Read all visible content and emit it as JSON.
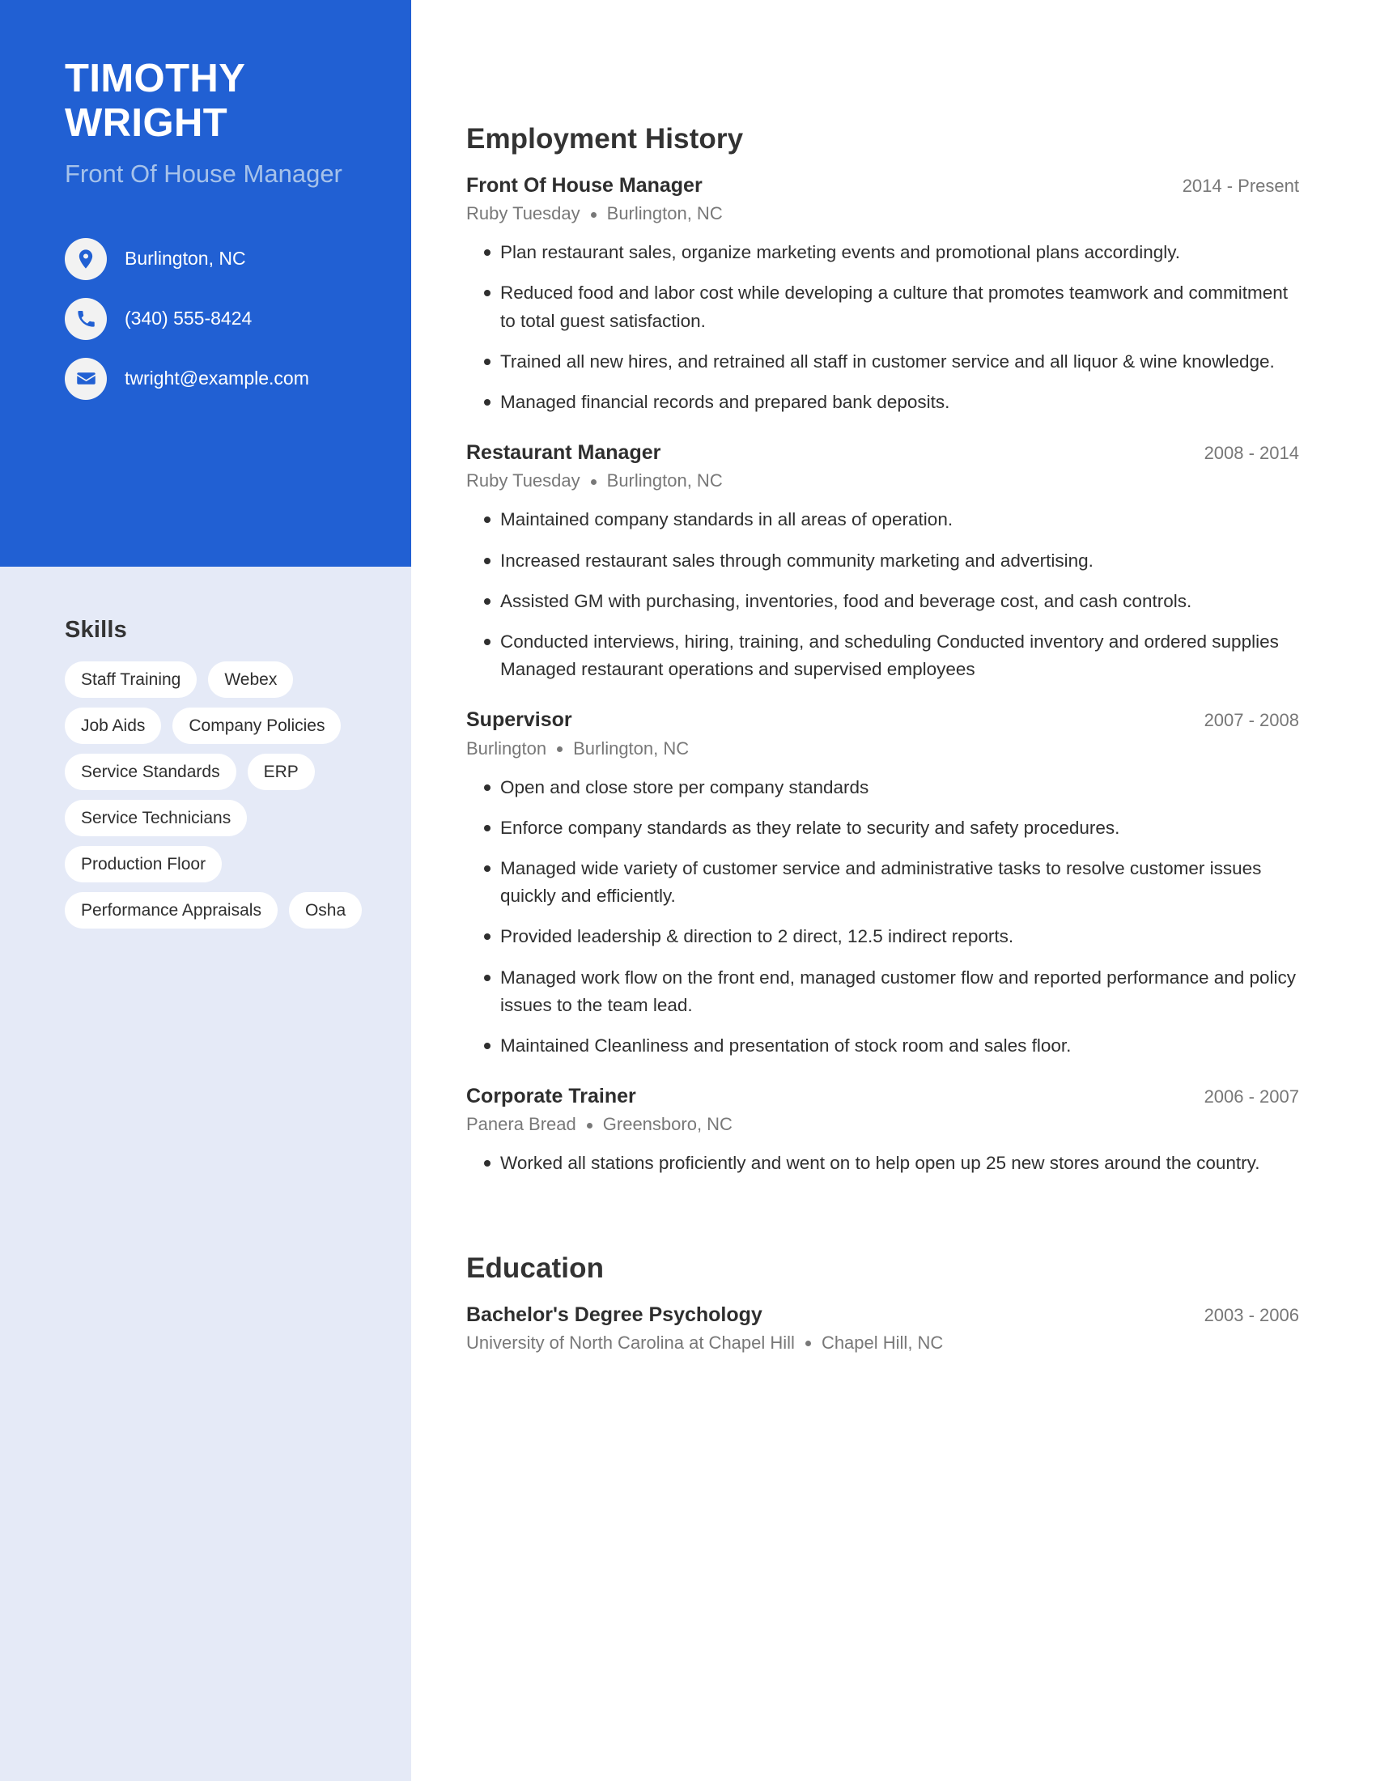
{
  "theme": {
    "accent_blue": "#2160d3",
    "sidebar_bg": "#e5eaf7",
    "subtitle_blue": "#a6c2ea",
    "body_text": "#2f2f2f",
    "muted_text": "#787878"
  },
  "sidebar": {
    "name": "TIMOTHY WRIGHT",
    "headline": "Front Of House Manager",
    "contact": [
      {
        "icon": "location-pin-icon",
        "label": "Burlington, NC"
      },
      {
        "icon": "phone-icon",
        "label": "(340) 555-8424"
      },
      {
        "icon": "envelope-icon",
        "label": "twright@example.com"
      }
    ],
    "skills_heading": "Skills",
    "skills": [
      "Staff Training",
      "Webex",
      "Job Aids",
      "Company Policies",
      "Service Standards",
      "ERP",
      "Service Technicians",
      "Production Floor",
      "Performance Appraisals",
      "Osha"
    ]
  },
  "main": {
    "employment": {
      "heading": "Employment History",
      "entries": [
        {
          "title": "Front Of House Manager",
          "dates": "2014 - Present",
          "company": "Ruby Tuesday",
          "location": "Burlington, NC",
          "bullets": [
            "Plan restaurant sales, organize marketing events and promotional plans accordingly.",
            "Reduced food and labor cost while developing a culture that promotes teamwork and commitment to total guest satisfaction.",
            "Trained all new hires, and retrained all staff in customer service and all liquor & wine knowledge.",
            "Managed financial records and prepared bank deposits."
          ]
        },
        {
          "title": "Restaurant Manager",
          "dates": "2008 - 2014",
          "company": "Ruby Tuesday",
          "location": "Burlington, NC",
          "bullets": [
            "Maintained company standards in all areas of operation.",
            "Increased restaurant sales through community marketing and advertising.",
            "Assisted GM with purchasing, inventories, food and beverage cost, and cash controls.",
            "Conducted interviews, hiring, training, and scheduling Conducted inventory and ordered supplies Managed restaurant operations and supervised employees"
          ]
        },
        {
          "title": "Supervisor",
          "dates": "2007 - 2008",
          "company": "Burlington",
          "location": "Burlington, NC",
          "bullets": [
            "Open and close store per company standards",
            "Enforce company standards as they relate to security and safety procedures.",
            "Managed wide variety of customer service and administrative tasks to resolve customer issues quickly and efficiently.",
            "Provided leadership & direction to 2 direct, 12.5 indirect reports.",
            "Managed work flow on the front end, managed customer flow and reported performance and policy issues to the team lead.",
            "Maintained Cleanliness and presentation of stock room and sales floor."
          ]
        },
        {
          "title": "Corporate Trainer",
          "dates": "2006 - 2007",
          "company": "Panera Bread",
          "location": "Greensboro, NC",
          "bullets": [
            "Worked all stations proficiently and went on to help open up 25 new stores around the country."
          ]
        }
      ]
    },
    "education": {
      "heading": "Education",
      "entries": [
        {
          "title": "Bachelor's Degree Psychology",
          "dates": "2003 - 2006",
          "company": "University of North Carolina at Chapel Hill",
          "location": "Chapel Hill, NC",
          "bullets": []
        }
      ]
    }
  }
}
